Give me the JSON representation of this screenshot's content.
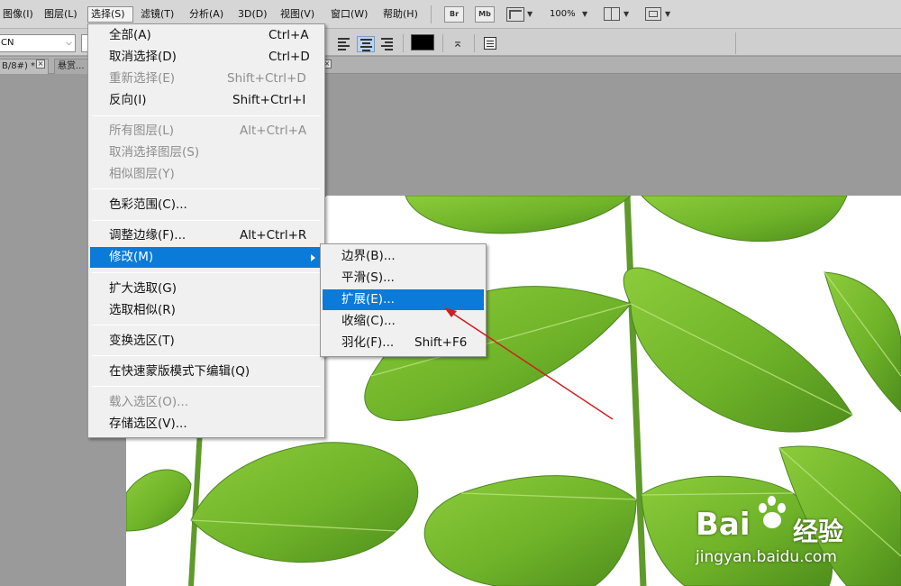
{
  "menubar": {
    "items": [
      {
        "label": "图像(I)"
      },
      {
        "label": "图层(L)"
      },
      {
        "label": "选择(S)"
      },
      {
        "label": "滤镜(T)"
      },
      {
        "label": "分析(A)"
      },
      {
        "label": "3D(D)"
      },
      {
        "label": "视图(V)"
      },
      {
        "label": "窗口(W)"
      },
      {
        "label": "帮助(H)"
      }
    ],
    "active_item": "选择(S)",
    "br_label": "Br",
    "mb_label": "Mb",
    "zoom": "100%"
  },
  "options": {
    "font_value": "CN",
    "text_color": "#000000"
  },
  "tabs": [
    {
      "label": "B/8#) *"
    },
    {
      "label": "悬赏..."
    }
  ],
  "select_menu": {
    "items": [
      {
        "label": "全部(A)",
        "shortcut": "Ctrl+A",
        "enabled": true
      },
      {
        "label": "取消选择(D)",
        "shortcut": "Ctrl+D",
        "enabled": true
      },
      {
        "label": "重新选择(E)",
        "shortcut": "Shift+Ctrl+D",
        "enabled": false
      },
      {
        "label": "反向(I)",
        "shortcut": "Shift+Ctrl+I",
        "enabled": true
      },
      {
        "label": "所有图层(L)",
        "shortcut": "Alt+Ctrl+A",
        "enabled": false
      },
      {
        "label": "取消选择图层(S)",
        "shortcut": "",
        "enabled": false
      },
      {
        "label": "相似图层(Y)",
        "shortcut": "",
        "enabled": false
      },
      {
        "label": "色彩范围(C)...",
        "shortcut": "",
        "enabled": true
      },
      {
        "label": "调整边缘(F)...",
        "shortcut": "Alt+Ctrl+R",
        "enabled": true
      },
      {
        "label": "修改(M)",
        "shortcut": "",
        "enabled": true,
        "highlighted": true,
        "has_submenu": true
      },
      {
        "label": "扩大选取(G)",
        "shortcut": "",
        "enabled": true
      },
      {
        "label": "选取相似(R)",
        "shortcut": "",
        "enabled": true
      },
      {
        "label": "变换选区(T)",
        "shortcut": "",
        "enabled": true
      },
      {
        "label": "在快速蒙版模式下编辑(Q)",
        "shortcut": "",
        "enabled": true
      },
      {
        "label": "载入选区(O)...",
        "shortcut": "",
        "enabled": false
      },
      {
        "label": "存储选区(V)...",
        "shortcut": "",
        "enabled": true
      }
    ]
  },
  "modify_submenu": {
    "items": [
      {
        "label": "边界(B)...",
        "shortcut": ""
      },
      {
        "label": "平滑(S)...",
        "shortcut": ""
      },
      {
        "label": "扩展(E)...",
        "shortcut": "",
        "highlighted": true
      },
      {
        "label": "收缩(C)...",
        "shortcut": ""
      },
      {
        "label": "羽化(F)...",
        "shortcut": "Shift+F6"
      }
    ]
  },
  "watermark": {
    "brand": "Bai",
    "brand_suffix": "经验",
    "url": "jingyan.baidu.com"
  },
  "colors": {
    "highlight": "#0a7bd9",
    "annotation_arrow": "#cc2020",
    "leaf": "#6fb329"
  }
}
